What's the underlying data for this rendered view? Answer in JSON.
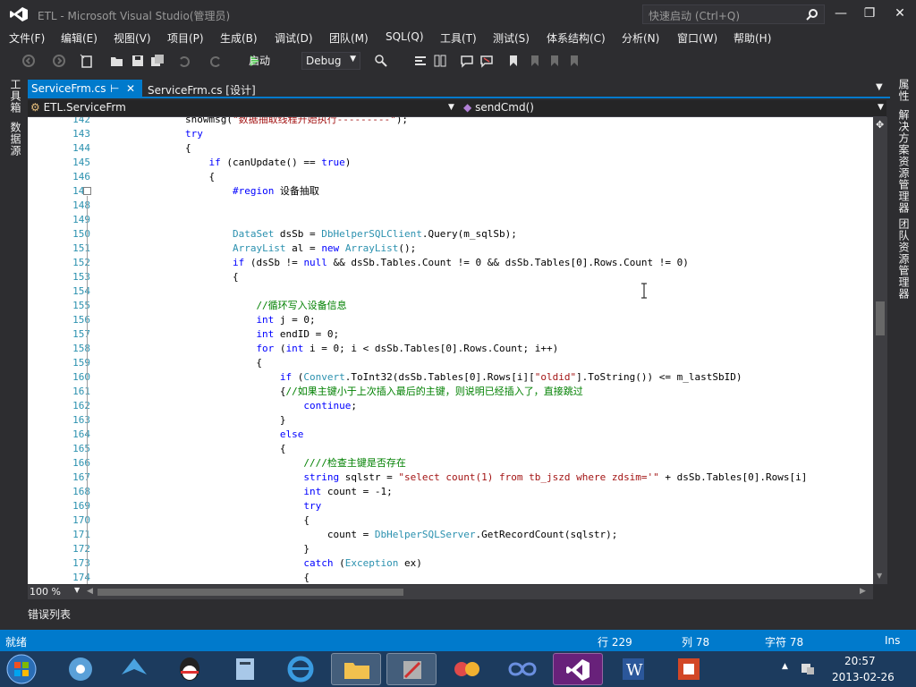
{
  "window": {
    "title": "ETL - Microsoft Visual Studio(管理员)",
    "quick_launch_placeholder": "快速启动 (Ctrl+Q)"
  },
  "menu": [
    "文件(F)",
    "编辑(E)",
    "视图(V)",
    "项目(P)",
    "生成(B)",
    "调试(D)",
    "团队(M)",
    "SQL(Q)",
    "工具(T)",
    "测试(S)",
    "体系结构(C)",
    "分析(N)",
    "窗口(W)",
    "帮助(H)"
  ],
  "toolbar": {
    "start_label": "启动",
    "config_value": "Debug"
  },
  "left_rail": [
    "工具箱",
    "数据源"
  ],
  "right_rail": [
    "属性",
    "解决方案资源管理器",
    "团队资源管理器"
  ],
  "tabs": {
    "active": "ServiceFrm.cs",
    "inactive": "ServiceFrm.cs [设计]"
  },
  "navbar": {
    "class_name": "ETL.ServiceFrm",
    "member_name": "sendCmd()"
  },
  "code": [
    {
      "n": "142",
      "t": "                showmsg(\"数据抽取线程开始执行---------\");"
    },
    {
      "n": "143",
      "t": "                try"
    },
    {
      "n": "144",
      "t": "                {"
    },
    {
      "n": "145",
      "t": "                    if (canUpdate() == true)"
    },
    {
      "n": "146",
      "t": "                    {"
    },
    {
      "n": "147",
      "t": "                        #region 设备抽取"
    },
    {
      "n": "148",
      "t": ""
    },
    {
      "n": "149",
      "t": ""
    },
    {
      "n": "150",
      "t": "                        DataSet dsSb = DbHelperSQLClient.Query(m_sqlSb);"
    },
    {
      "n": "151",
      "t": "                        ArrayList al = new ArrayList();"
    },
    {
      "n": "152",
      "t": "                        if (dsSb != null && dsSb.Tables.Count != 0 && dsSb.Tables[0].Rows.Count != 0)"
    },
    {
      "n": "153",
      "t": "                        {"
    },
    {
      "n": "154",
      "t": ""
    },
    {
      "n": "155",
      "t": "                            //循环写入设备信息"
    },
    {
      "n": "156",
      "t": "                            int j = 0;"
    },
    {
      "n": "157",
      "t": "                            int endID = 0;"
    },
    {
      "n": "158",
      "t": "                            for (int i = 0; i < dsSb.Tables[0].Rows.Count; i++)"
    },
    {
      "n": "159",
      "t": "                            {"
    },
    {
      "n": "160",
      "t": "                                if (Convert.ToInt32(dsSb.Tables[0].Rows[i][\"oldid\"].ToString()) <= m_lastSbID)"
    },
    {
      "n": "161",
      "t": "                                {//如果主键小于上次插入最后的主键，则说明已经插入了，直接跳过"
    },
    {
      "n": "162",
      "t": "                                    continue;"
    },
    {
      "n": "163",
      "t": "                                }"
    },
    {
      "n": "164",
      "t": "                                else"
    },
    {
      "n": "165",
      "t": "                                {"
    },
    {
      "n": "166",
      "t": "                                    ////检查主键是否存在"
    },
    {
      "n": "167",
      "t": "                                    string sqlstr = \"select count(1) from tb_jszd where zdsim='\" + dsSb.Tables[0].Rows[i]"
    },
    {
      "n": "168",
      "t": "                                    int count = -1;"
    },
    {
      "n": "169",
      "t": "                                    try"
    },
    {
      "n": "170",
      "t": "                                    {"
    },
    {
      "n": "171",
      "t": "                                        count = DbHelperSQLServer.GetRecordCount(sqlstr);"
    },
    {
      "n": "172",
      "t": "                                    }"
    },
    {
      "n": "173",
      "t": "                                    catch (Exception ex)"
    },
    {
      "n": "174",
      "t": "                                    {"
    }
  ],
  "editor": {
    "zoom": "100 %"
  },
  "bottom_panel": {
    "error_list": "错误列表"
  },
  "status": {
    "ready": "就绪",
    "line": "行 229",
    "col": "列 78",
    "char": "字符 78",
    "mode": "Ins"
  },
  "clock": {
    "time": "20:57",
    "date": "2013-02-26"
  }
}
